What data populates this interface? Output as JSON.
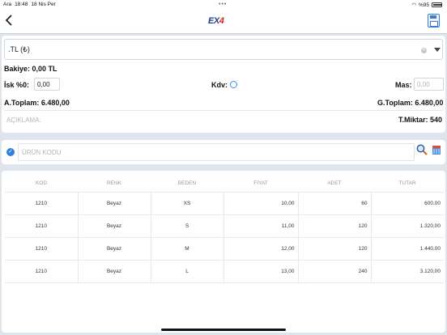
{
  "status_bar": {
    "carrier": "Ara",
    "time": "18:48",
    "date": "18 Nis Per",
    "battery": "%95"
  },
  "nav": {
    "back_icon": "chevron-left-icon",
    "logo_ex": "EX",
    "logo_4": "4",
    "save_icon": "floppy-disk-icon"
  },
  "form": {
    "currency": ".TL (₺)",
    "balance": "Bakiye: 0,00 TL",
    "discount_label": "İsk %0:",
    "discount_value": "0,00",
    "vat_label": "Kdv:",
    "mas_label": "Mas:",
    "mas_placeholder": "0,00",
    "subtotal": "A.Toplam: 6.480,00",
    "grand_total": "G.Toplam: 6.480,00",
    "description_placeholder": "AÇIKLAMA:",
    "total_qty": "T.Miktar: 540"
  },
  "product_search": {
    "placeholder": "ÜRÜN KODU"
  },
  "table": {
    "columns": [
      "KOD",
      "RENK",
      "BEDEN",
      "FİYAT",
      "ADET",
      "TUTAR"
    ],
    "rows": [
      [
        "1210",
        "Beyaz",
        "XS",
        "10,00",
        "60",
        "600,00"
      ],
      [
        "1210",
        "Beyaz",
        "S",
        "11,00",
        "120",
        "1.320,00"
      ],
      [
        "1210",
        "Beyaz",
        "M",
        "12,00",
        "120",
        "1.440,00"
      ],
      [
        "1210",
        "Beyaz",
        "L",
        "13,00",
        "240",
        "3.120,00"
      ]
    ]
  },
  "colors": {
    "accent": "#2f7fe0",
    "logo_blue": "#1f3d8a",
    "logo_red": "#d62020",
    "background": "#dfe5ec"
  }
}
